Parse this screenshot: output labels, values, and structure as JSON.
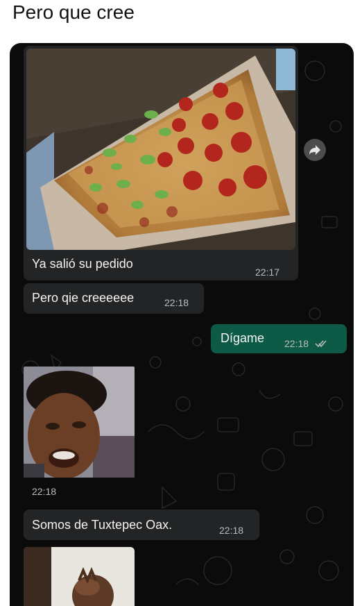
{
  "post": {
    "caption": "Pero que cree"
  },
  "messages": {
    "m1": {
      "text": "Ya salió su pedido",
      "time": "22:17",
      "image": "pizza-photo"
    },
    "m2": {
      "text": "Pero qie creeeeee",
      "time": "22:18"
    },
    "m3": {
      "text": "Dígame",
      "time": "22:18",
      "status": "read"
    },
    "m4": {
      "time": "22:18",
      "image": "crying-child-photo"
    },
    "m5": {
      "text": "Somos de Tuxtepec Oax.",
      "time": "22:18"
    },
    "m6": {
      "image": "child-covering-face-photo"
    }
  },
  "colors": {
    "chat_bg": "#0b0b0c",
    "incoming_bubble": "#222426",
    "outgoing_bubble": "#0d5a46",
    "timestamp": "#b9bdbf",
    "read_ticks": "#53bdeb"
  },
  "icons": {
    "forward": "share-forward-icon",
    "read_receipt": "double-check-icon"
  }
}
